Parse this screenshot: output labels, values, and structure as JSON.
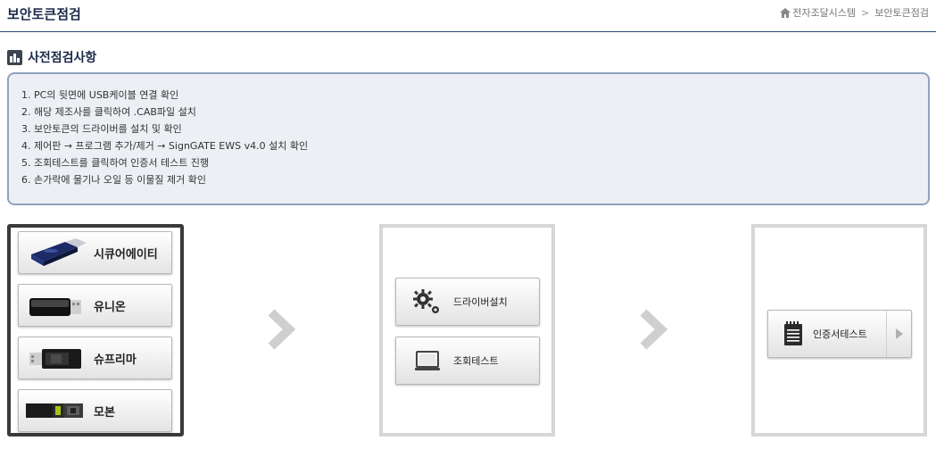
{
  "header": {
    "title": "보안토큰점검",
    "breadcrumb": [
      "전자조달시스템",
      "보안토큰점검"
    ],
    "breadcrumb_separator": ">"
  },
  "section": {
    "title": "사전점검사항"
  },
  "checklist": [
    "1. PC의 뒷면에 USB케이블 연결 확인",
    "2. 해당 제조사를 클릭하여 .CAB파일 설치",
    "3. 보안토큰의 드라이버를 설치 및 확인",
    "4. 제어판 → 프로그램 추가/제거 → SignGATE EWS v4.0 설치 확인",
    "5. 조회테스트를 클릭하여 인증서 테스트 진행",
    "6. 손가락에 물기나 오일 등 이물질 제거 확인"
  ],
  "vendors": [
    {
      "label": "시큐어에이티",
      "icon": "usb-token-icon"
    },
    {
      "label": "유니온",
      "icon": "usb-token-icon"
    },
    {
      "label": "슈프리마",
      "icon": "usb-token-icon"
    },
    {
      "label": "모본",
      "icon": "usb-token-icon"
    }
  ],
  "actions": {
    "driver_install": "드라이버설치",
    "lookup_test": "조회테스트",
    "cert_test": "인증서테스트"
  },
  "colors": {
    "title": "#1a2a4a",
    "checklist_border": "#8fa2bf",
    "checklist_bg": "#eceff3",
    "arrow": "#cccccc"
  }
}
